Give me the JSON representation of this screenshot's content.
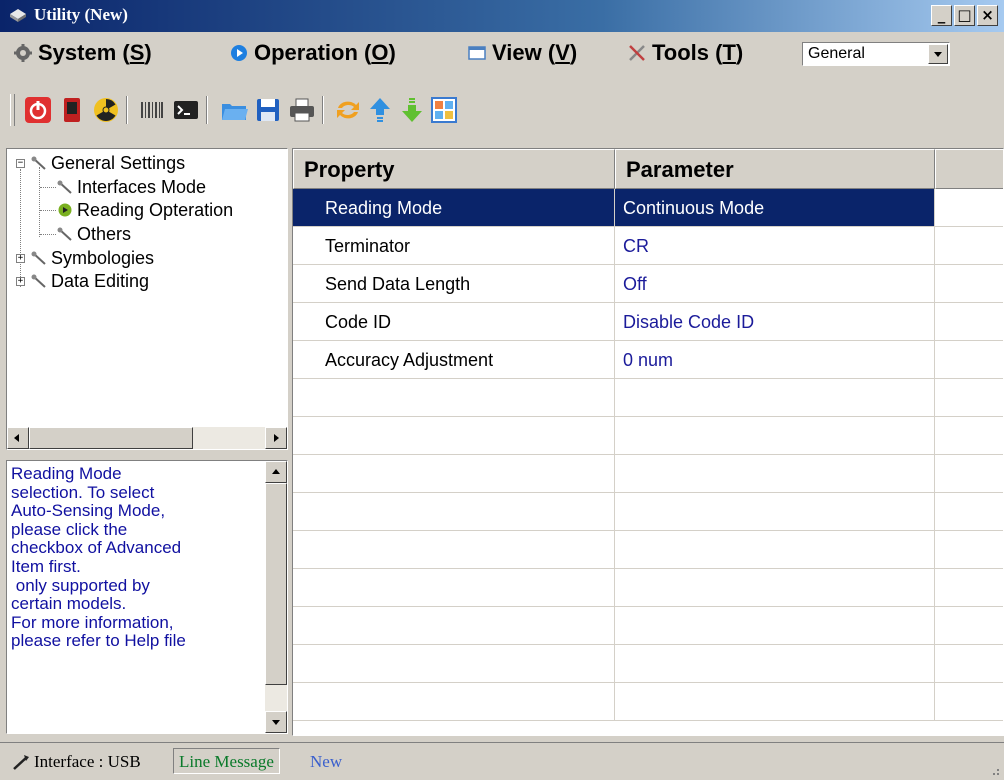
{
  "window": {
    "title": "Utility (New)"
  },
  "menu": {
    "system": {
      "label_pre": "System (",
      "key": "S",
      "label_post": ")"
    },
    "operation": {
      "label_pre": "Operation (",
      "key": "O",
      "label_post": ")"
    },
    "view": {
      "label_pre": "View (",
      "key": "V",
      "label_post": ")"
    },
    "tools": {
      "label_pre": "Tools (",
      "key": "T",
      "label_post": ")"
    },
    "profile_select": {
      "value": "General"
    }
  },
  "toolbar": {
    "icons": [
      "power-icon",
      "device-icon",
      "radiation-icon",
      "barcode-icon",
      "terminal-icon",
      "open-folder-icon",
      "save-icon",
      "print-icon",
      "refresh-icon",
      "upload-icon",
      "download-icon",
      "layout-icon"
    ]
  },
  "tree": {
    "items": [
      {
        "label": "General Settings",
        "expander": "−"
      },
      {
        "label": "Interfaces Mode"
      },
      {
        "label": "Reading Opteration"
      },
      {
        "label": "Others"
      },
      {
        "label": "Symbologies",
        "expander": "+"
      },
      {
        "label": "Data Editing",
        "expander": "+"
      }
    ]
  },
  "description": {
    "text": "Reading Mode\nselection. To select\nAuto-Sensing Mode,\nplease click the\ncheckbox of Advanced\nItem first.\n only supported by\ncertain models.\nFor more information,\nplease refer to Help file"
  },
  "grid": {
    "headers": {
      "property": "Property",
      "parameter": "Parameter"
    },
    "rows": [
      {
        "property": "Reading Mode",
        "parameter": "Continuous Mode"
      },
      {
        "property": "Terminator",
        "parameter": "CR"
      },
      {
        "property": "Send Data Length",
        "parameter": "Off"
      },
      {
        "property": "Code ID",
        "parameter": "Disable Code ID"
      },
      {
        "property": "Accuracy Adjustment",
        "parameter": "0 num"
      }
    ],
    "selected_row": 0
  },
  "status": {
    "interface": "Interface : USB",
    "message": "Line Message",
    "state": "New"
  },
  "colors": {
    "selection": "#0a246a",
    "parameter_text": "#1b1b9a",
    "description_text": "#1010a0",
    "status_message": "#0a7a2a",
    "status_state": "#3a5fcd"
  }
}
